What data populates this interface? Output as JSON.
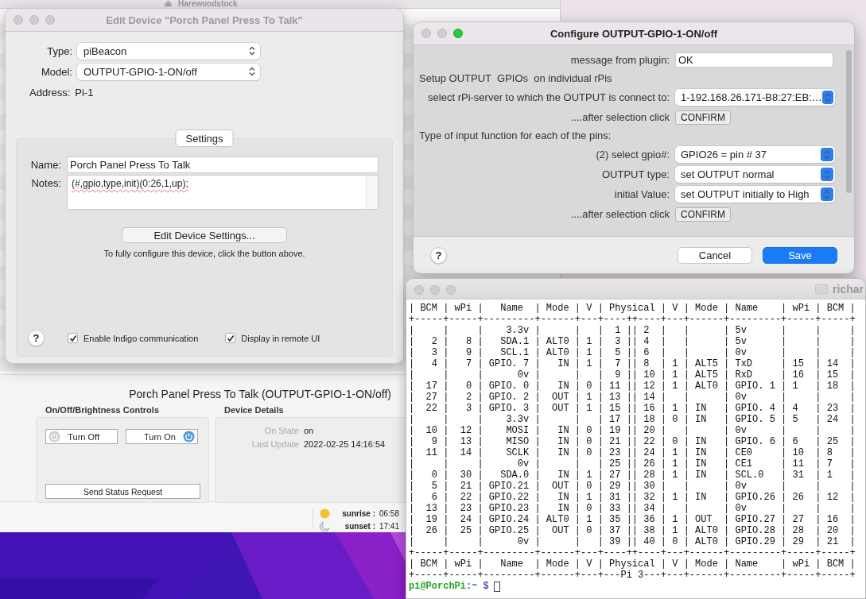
{
  "background_window": {
    "title": "Harewoodstock",
    "device_heading": "Porch Panel Press To Talk (OUTPUT-GPIO-1-ON/off)",
    "controls": {
      "title": "On/Off/Brightness Controls",
      "buttons": [
        {
          "label": "Turn Off",
          "kind": "off"
        },
        {
          "label": "Turn On",
          "kind": "on"
        }
      ],
      "status_button": "Send Status Request"
    },
    "details": {
      "title": "Device Details",
      "rows": [
        {
          "label": "On State",
          "value": "on"
        },
        {
          "label": "Last Update",
          "value": "2022-02-25 14:16:54"
        }
      ]
    },
    "status_bar": [
      {
        "kind": "sun",
        "label": "sunrise :",
        "time": "06:58"
      },
      {
        "kind": "moon",
        "label": "sunset :",
        "time": "17:41"
      }
    ]
  },
  "edit_device": {
    "title": "Edit Device \"Porch Panel Press To Talk\"",
    "active": false,
    "popups": [
      {
        "label": "Type:",
        "value": "piBeacon"
      },
      {
        "label": "Model:",
        "value": "OUTPUT-GPIO-1-ON/off"
      }
    ],
    "address": {
      "label": "Address:",
      "value": "Pi-1"
    },
    "settings_tab": "Settings",
    "name": {
      "label": "Name:",
      "value": "Porch Panel Press To Talk"
    },
    "notes": {
      "label": "Notes:",
      "value": "(#,gpio,type,init)(0:26,1,up);"
    },
    "edit_button": "Edit Device Settings...",
    "hint": "To fully configure this device, click the button above.",
    "help": "?",
    "checkboxes": [
      {
        "label": "Enable Indigo communication",
        "checked": true
      },
      {
        "label": "Display in remote UI",
        "checked": true
      }
    ]
  },
  "configure": {
    "title": "Configure OUTPUT-GPIO-1-ON/off",
    "active": true,
    "rows": [
      {
        "kind": "field",
        "label": "message from plugin:",
        "value": "OK"
      },
      {
        "kind": "text",
        "text": "Setup OUTPUT  GPIOs  on individual rPis"
      },
      {
        "kind": "popup",
        "label": "select rPi-server to which the OUTPUT is connect to:",
        "value": "1-192.168.26.171-B8:27:EB:…"
      },
      {
        "kind": "button",
        "label": "....after selection click",
        "value": "CONFIRM"
      },
      {
        "kind": "text",
        "text": "Type of input function for each of the pins:"
      },
      {
        "kind": "popup",
        "label": "(2) select gpio#:",
        "value": "GPIO26 = pin # 37"
      },
      {
        "kind": "popup",
        "label": "OUTPUT type:",
        "value": "set OUTPUT normal"
      },
      {
        "kind": "popup",
        "label": "initial Value:",
        "value": "set OUTPUT initially to High"
      },
      {
        "kind": "button",
        "label": "....after selection click",
        "value": "CONFIRM"
      }
    ],
    "help": "?",
    "buttons": [
      {
        "label": "Cancel",
        "kind": "secondary"
      },
      {
        "label": "Save",
        "kind": "default"
      }
    ]
  },
  "terminal": {
    "title": "richar",
    "active": false,
    "lines": [
      "| BCM | wPi |   Name  | Mode | V | Physical | V | Mode | Name    | wPi | BCM |",
      "+-----+-----+---------+------+---+----++----+---+------+---------+-----+-----+",
      "|     |     |    3.3v |      |   |  1 || 2  |   |      | 5v      |     |     |",
      "|   2 |   8 |   SDA.1 | ALT0 | 1 |  3 || 4  |   |      | 5v      |     |     |",
      "|   3 |   9 |   SCL.1 | ALT0 | 1 |  5 || 6  |   |      | 0v      |     |     |",
      "|   4 |   7 | GPIO. 7 |   IN | 1 |  7 || 8  | 1 | ALT5 | TxD     | 15  | 14  |",
      "|     |     |      0v |      |   |  9 || 10 | 1 | ALT5 | RxD     | 16  | 15  |",
      "|  17 |   0 | GPIO. 0 |   IN | 0 | 11 || 12 | 1 | ALT0 | GPIO. 1 | 1   | 18  |",
      "|  27 |   2 | GPIO. 2 |  OUT | 1 | 13 || 14 |   |      | 0v      |     |     |",
      "|  22 |   3 | GPIO. 3 |  OUT | 1 | 15 || 16 | 1 | IN   | GPIO. 4 | 4   | 23  |",
      "|     |     |    3.3v |      |   | 17 || 18 | 0 | IN   | GPIO. 5 | 5   | 24  |",
      "|  10 |  12 |    MOSI |   IN | 0 | 19 || 20 |   |      | 0v      |     |     |",
      "|   9 |  13 |    MISO |   IN | 0 | 21 || 22 | 0 | IN   | GPIO. 6 | 6   | 25  |",
      "|  11 |  14 |    SCLK |   IN | 0 | 23 || 24 | 1 | IN   | CE0     | 10  | 8   |",
      "|     |     |      0v |      |   | 25 || 26 | 1 | IN   | CE1     | 11  | 7   |",
      "|   0 |  30 |   SDA.0 |   IN | 1 | 27 || 28 | 1 | IN   | SCL.0   | 31  | 1   |",
      "|   5 |  21 | GPIO.21 |  OUT | 0 | 29 || 30 |   |      | 0v      |     |     |",
      "|   6 |  22 | GPIO.22 |   IN | 1 | 31 || 32 | 1 | IN   | GPIO.26 | 26  | 12  |",
      "|  13 |  23 | GPIO.23 |   IN | 0 | 33 || 34 |   |      | 0v      |     |     |",
      "|  19 |  24 | GPIO.24 | ALT0 | 1 | 35 || 36 | 1 | OUT  | GPIO.27 | 27  | 16  |",
      "|  26 |  25 | GPIO.25 |  OUT | 0 | 37 || 38 | 1 | ALT0 | GPIO.28 | 28  | 20  |",
      "|     |     |      0v |      |   | 39 || 40 | 0 | ALT0 | GPIO.29 | 29  | 21  |",
      "+-----+-----+---------+------+---+----++----+---+------+---------+-----+-----+",
      "| BCM | wPi |   Name  | Mode | V | Physical | V | Mode | Name    | wPi | BCM |",
      "+-----+-----+---------+------+---+---Pi 3---+---+------+---------+-----+-----+"
    ],
    "prompt": {
      "user_host": "pi@PorchPi",
      "path": ":~",
      "symbol": "$"
    }
  }
}
